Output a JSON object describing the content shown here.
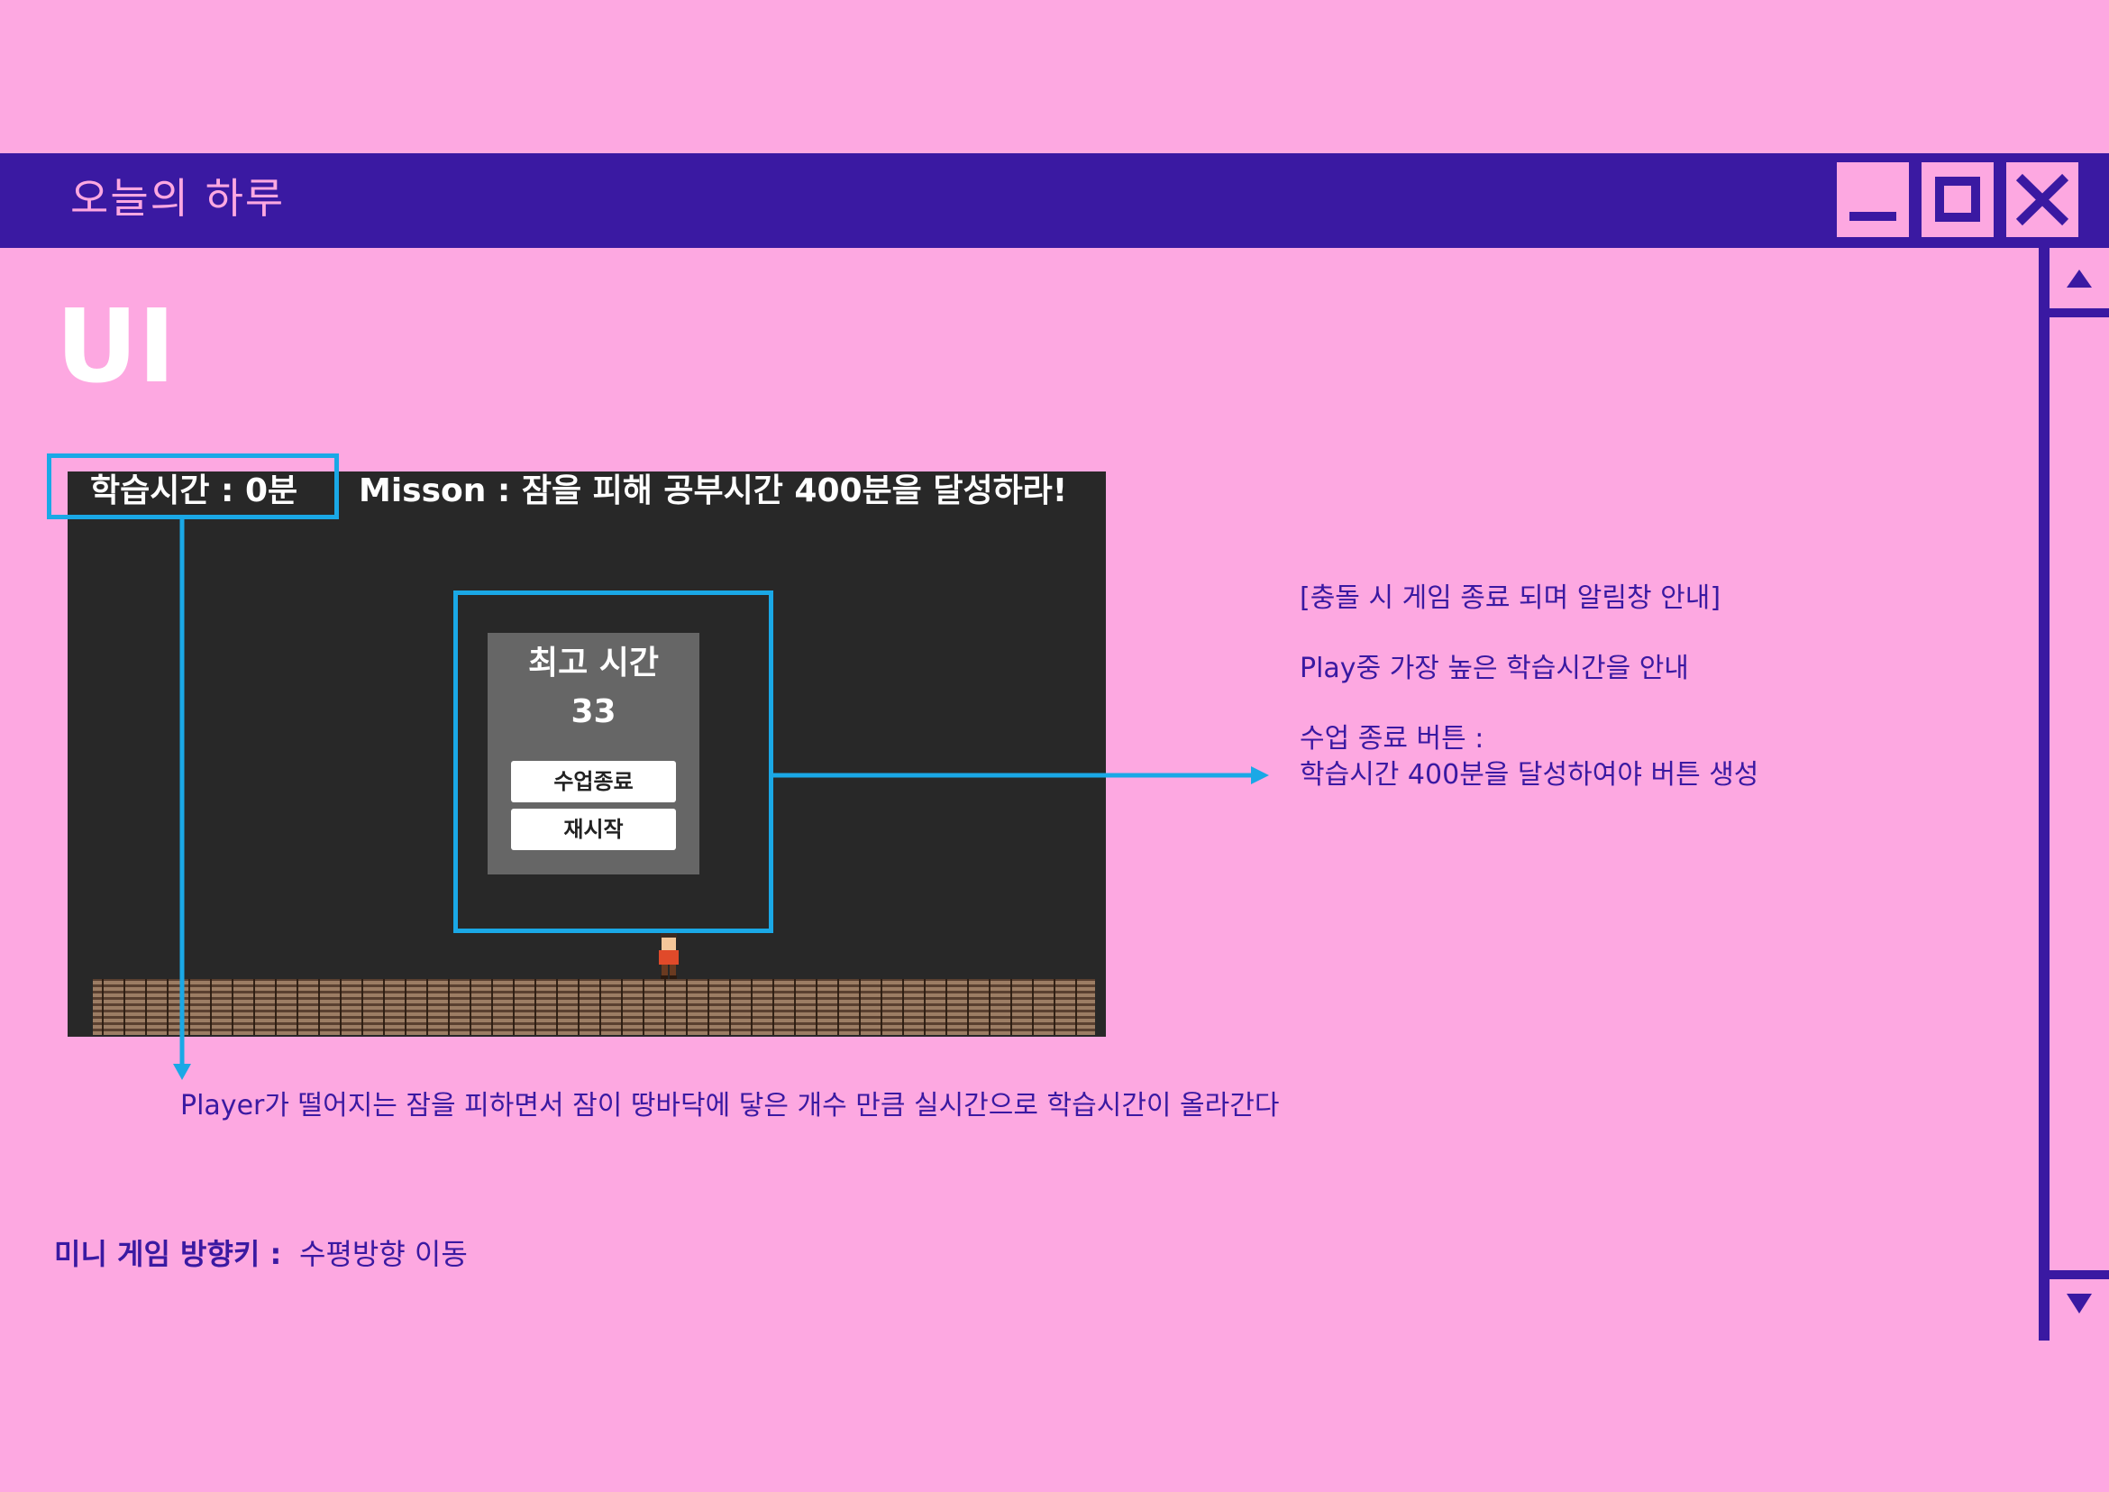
{
  "window": {
    "title": "오늘의 하루",
    "buttons": {
      "minimize": "minimize-icon",
      "maximize": "maximize-icon",
      "close": "close-icon"
    }
  },
  "slide": {
    "heading": "UI"
  },
  "game": {
    "hud": {
      "time": "학습시간 : 0분",
      "mission": "Misson : 잠을 피해 공부시간 400분을 달성하라!"
    },
    "popup": {
      "title": "최고 시간",
      "score": "33",
      "end_button": "수업종료",
      "restart_button": "재시작"
    }
  },
  "notes": {
    "popup_header": "[충돌 시 게임 종료 되며 알림창 안내]",
    "popup_best": "Play중 가장 높은 학습시간을 안내",
    "popup_end_1": "수업 종료 버튼 :",
    "popup_end_2": "학습시간 400분을 달성하여야 버튼 생성",
    "hud_time": "Player가 떨어지는 잠을 피하면서 잠이 땅바닥에 닿은 개수 만큼 실시간으로 학습시간이 올라간다"
  },
  "footer": {
    "label": "미니 게임 방향키 :",
    "text": "수평방향 이동"
  },
  "colors": {
    "background": "#fda8e1",
    "window_bar": "#3a19a2",
    "highlight": "#1aa8e6",
    "game_bg": "#282828",
    "popup_bg": "#666666"
  }
}
